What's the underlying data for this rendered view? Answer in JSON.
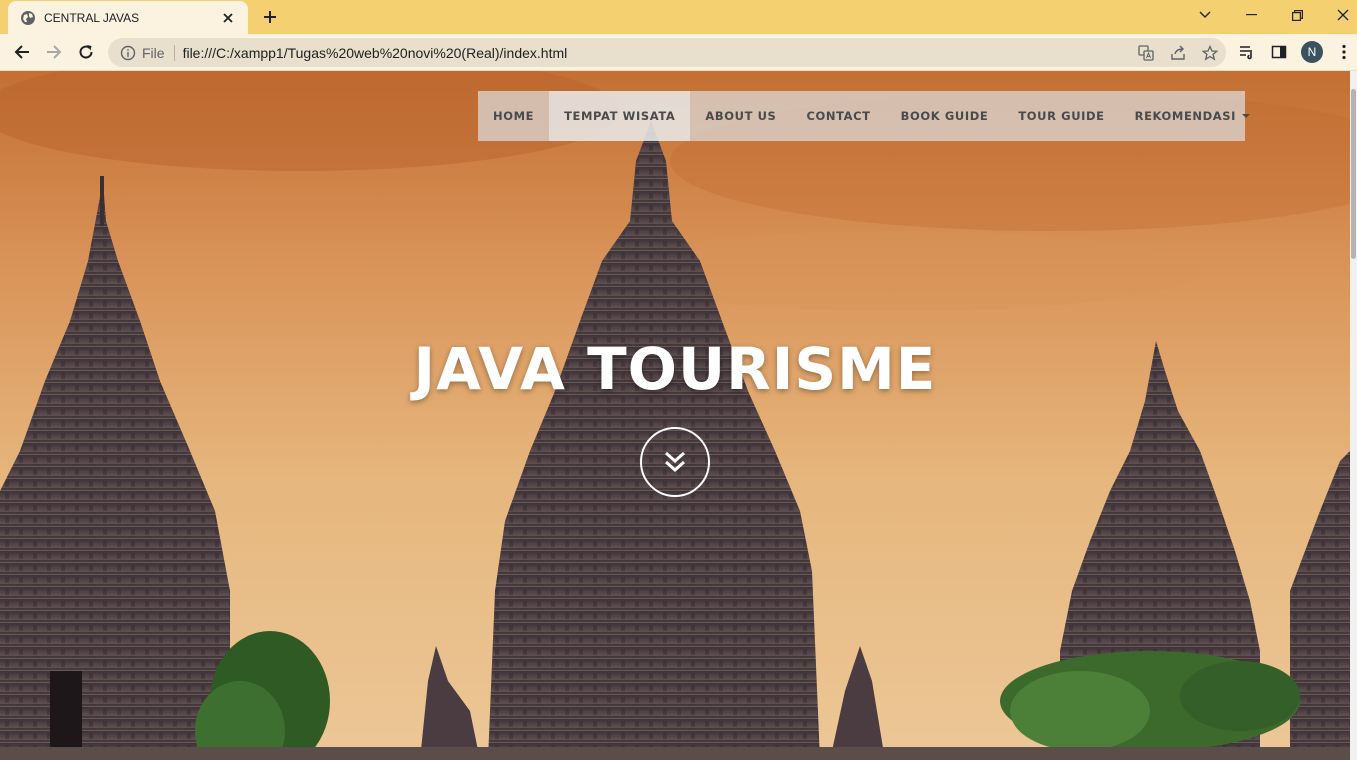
{
  "browser": {
    "tab_title": "CENTRAL JAVAS",
    "scheme_label": "File",
    "url": "file:///C:/xampp1/Tugas%20web%20novi%20(Real)/index.html",
    "profile_initial": "N"
  },
  "site": {
    "nav": [
      {
        "label": "HOME"
      },
      {
        "label": "TEMPAT WISATA"
      },
      {
        "label": "ABOUT US"
      },
      {
        "label": "CONTACT"
      },
      {
        "label": "BOOK GUIDE"
      },
      {
        "label": "TOUR GUIDE"
      },
      {
        "label": "REKOMENDASI"
      }
    ],
    "hero_title": "JAVA TOURISME"
  },
  "colors": {
    "tabstrip": "#f4d070",
    "toolbar": "#fbf3df",
    "sky_top": "#c9783a",
    "sky_bottom": "#e9c58d",
    "temple": "#4a3c40"
  }
}
